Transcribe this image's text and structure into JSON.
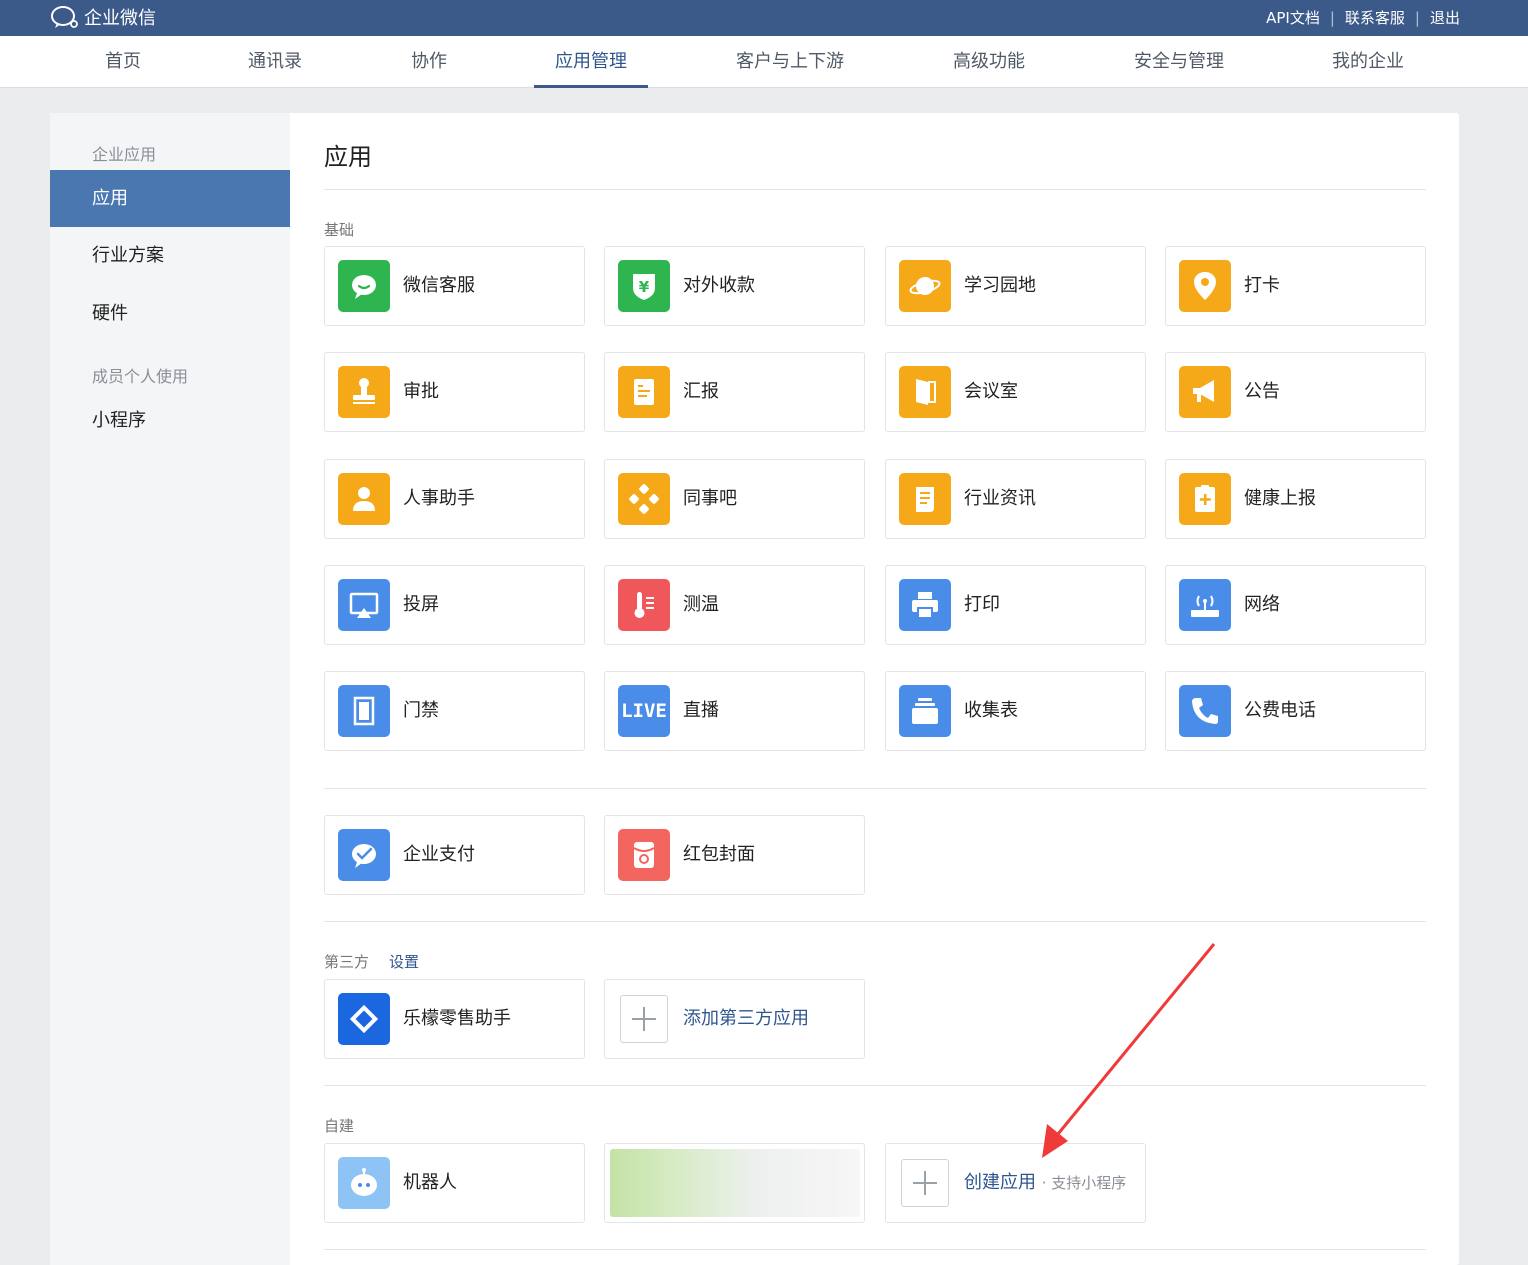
{
  "brand": {
    "name": "企业微信"
  },
  "top_links": [
    "API文档",
    "联系客服",
    "退出"
  ],
  "top_link_separator": "|",
  "nav_tabs": [
    "首页",
    "通讯录",
    "协作",
    "应用管理",
    "客户与上下游",
    "高级功能",
    "安全与管理",
    "我的企业"
  ],
  "active_tab": "应用管理",
  "sidebar": {
    "group1": "企业应用",
    "items1": [
      "应用",
      "行业方案",
      "硬件"
    ],
    "group2": "成员个人使用",
    "items2": [
      "小程序"
    ]
  },
  "page_title": "应用",
  "sections": {
    "basic": "基础",
    "third_party": "第三方",
    "third_party_link": "设置",
    "self_built": "自建"
  },
  "basic_apps": [
    {
      "name": "微信客服",
      "icon": "wechat-service-icon"
    },
    {
      "name": "对外收款",
      "icon": "payment-shield-icon"
    },
    {
      "name": "学习园地",
      "icon": "planet-icon"
    },
    {
      "name": "打卡",
      "icon": "location-pin-icon"
    },
    {
      "name": "审批",
      "icon": "stamp-icon"
    },
    {
      "name": "汇报",
      "icon": "report-icon"
    },
    {
      "name": "会议室",
      "icon": "door-icon"
    },
    {
      "name": "公告",
      "icon": "megaphone-icon"
    },
    {
      "name": "人事助手",
      "icon": "person-icon"
    },
    {
      "name": "同事吧",
      "icon": "network-icon"
    },
    {
      "name": "行业资讯",
      "icon": "scroll-icon"
    },
    {
      "name": "健康上报",
      "icon": "health-icon"
    },
    {
      "name": "投屏",
      "icon": "airplay-icon"
    },
    {
      "name": "测温",
      "icon": "thermometer-icon"
    },
    {
      "name": "打印",
      "icon": "printer-icon"
    },
    {
      "name": "网络",
      "icon": "router-icon"
    },
    {
      "name": "门禁",
      "icon": "door-access-icon"
    },
    {
      "name": "直播",
      "icon": "live-icon"
    },
    {
      "name": "收集表",
      "icon": "collect-icon"
    },
    {
      "name": "公费电话",
      "icon": "phone-icon"
    }
  ],
  "live_badge": "LIVE",
  "pay_apps": [
    {
      "name": "企业支付",
      "icon": "enterprise-pay-icon"
    },
    {
      "name": "红包封面",
      "icon": "red-packet-icon"
    }
  ],
  "third_party_apps": [
    {
      "name": "乐檬零售助手",
      "icon": "lemon-retail-icon"
    },
    {
      "name": "添加第三方应用",
      "icon": "plus-icon"
    }
  ],
  "self_built_apps": [
    {
      "name": "机器人",
      "icon": "robot-icon"
    },
    {
      "name": "创建应用",
      "sub": "· 支持小程序",
      "icon": "plus-icon"
    }
  ],
  "colors": {
    "topbar": "#3b5a89",
    "active_side": "#4a77b0",
    "link": "#2f568f",
    "annotation_arrow": "#f03a3a"
  }
}
